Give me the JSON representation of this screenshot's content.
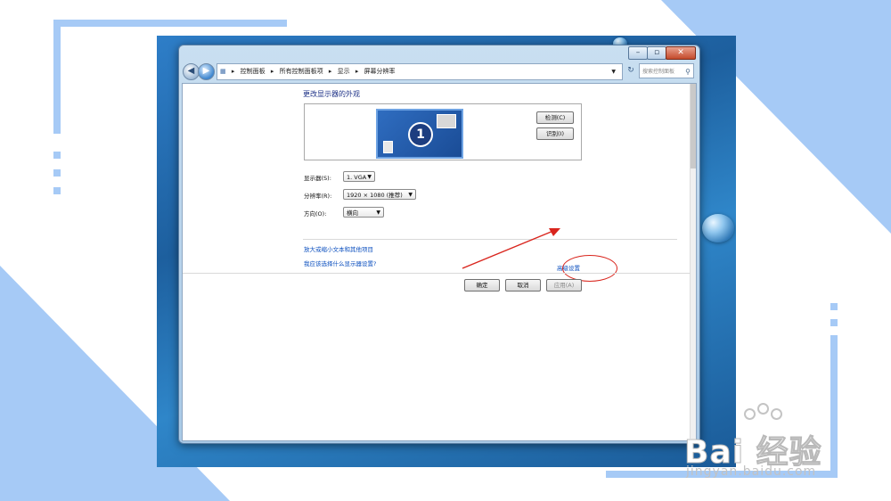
{
  "window": {
    "caption_buttons": {
      "minimize": "–",
      "maximize": "▫",
      "close": "✕"
    }
  },
  "navbar": {
    "back": "◀",
    "forward": "▶",
    "breadcrumbs": [
      "控制面板",
      "所有控制面板项",
      "显示",
      "屏幕分辨率"
    ],
    "separator": "▸",
    "refresh": "↻",
    "search_placeholder": "搜索控制面板"
  },
  "content": {
    "heading": "更改显示器的外观",
    "monitor_number": "1",
    "detect_button": "检测(C)",
    "identify_button": "识别(I)",
    "display_label": "显示器(S):",
    "display_value": "1. VGA",
    "resolution_label": "分辨率(R):",
    "resolution_value": "1920 × 1080 (推荐)",
    "orientation_label": "方向(O):",
    "orientation_value": "横向",
    "advanced_link": "高级设置",
    "link_text_size": "放大或缩小文本和其他项目",
    "link_which_settings": "我应该选择什么显示器设置?",
    "ok_button": "确定",
    "cancel_button": "取消",
    "apply_button": "应用(A)"
  },
  "watermark": {
    "main": "Bai 经验",
    "url": "jingyan.baidu.com"
  },
  "colors": {
    "slide_accent": "#a6caf6",
    "annotation_red": "#d9251d",
    "link_blue": "#0b4fbf"
  }
}
